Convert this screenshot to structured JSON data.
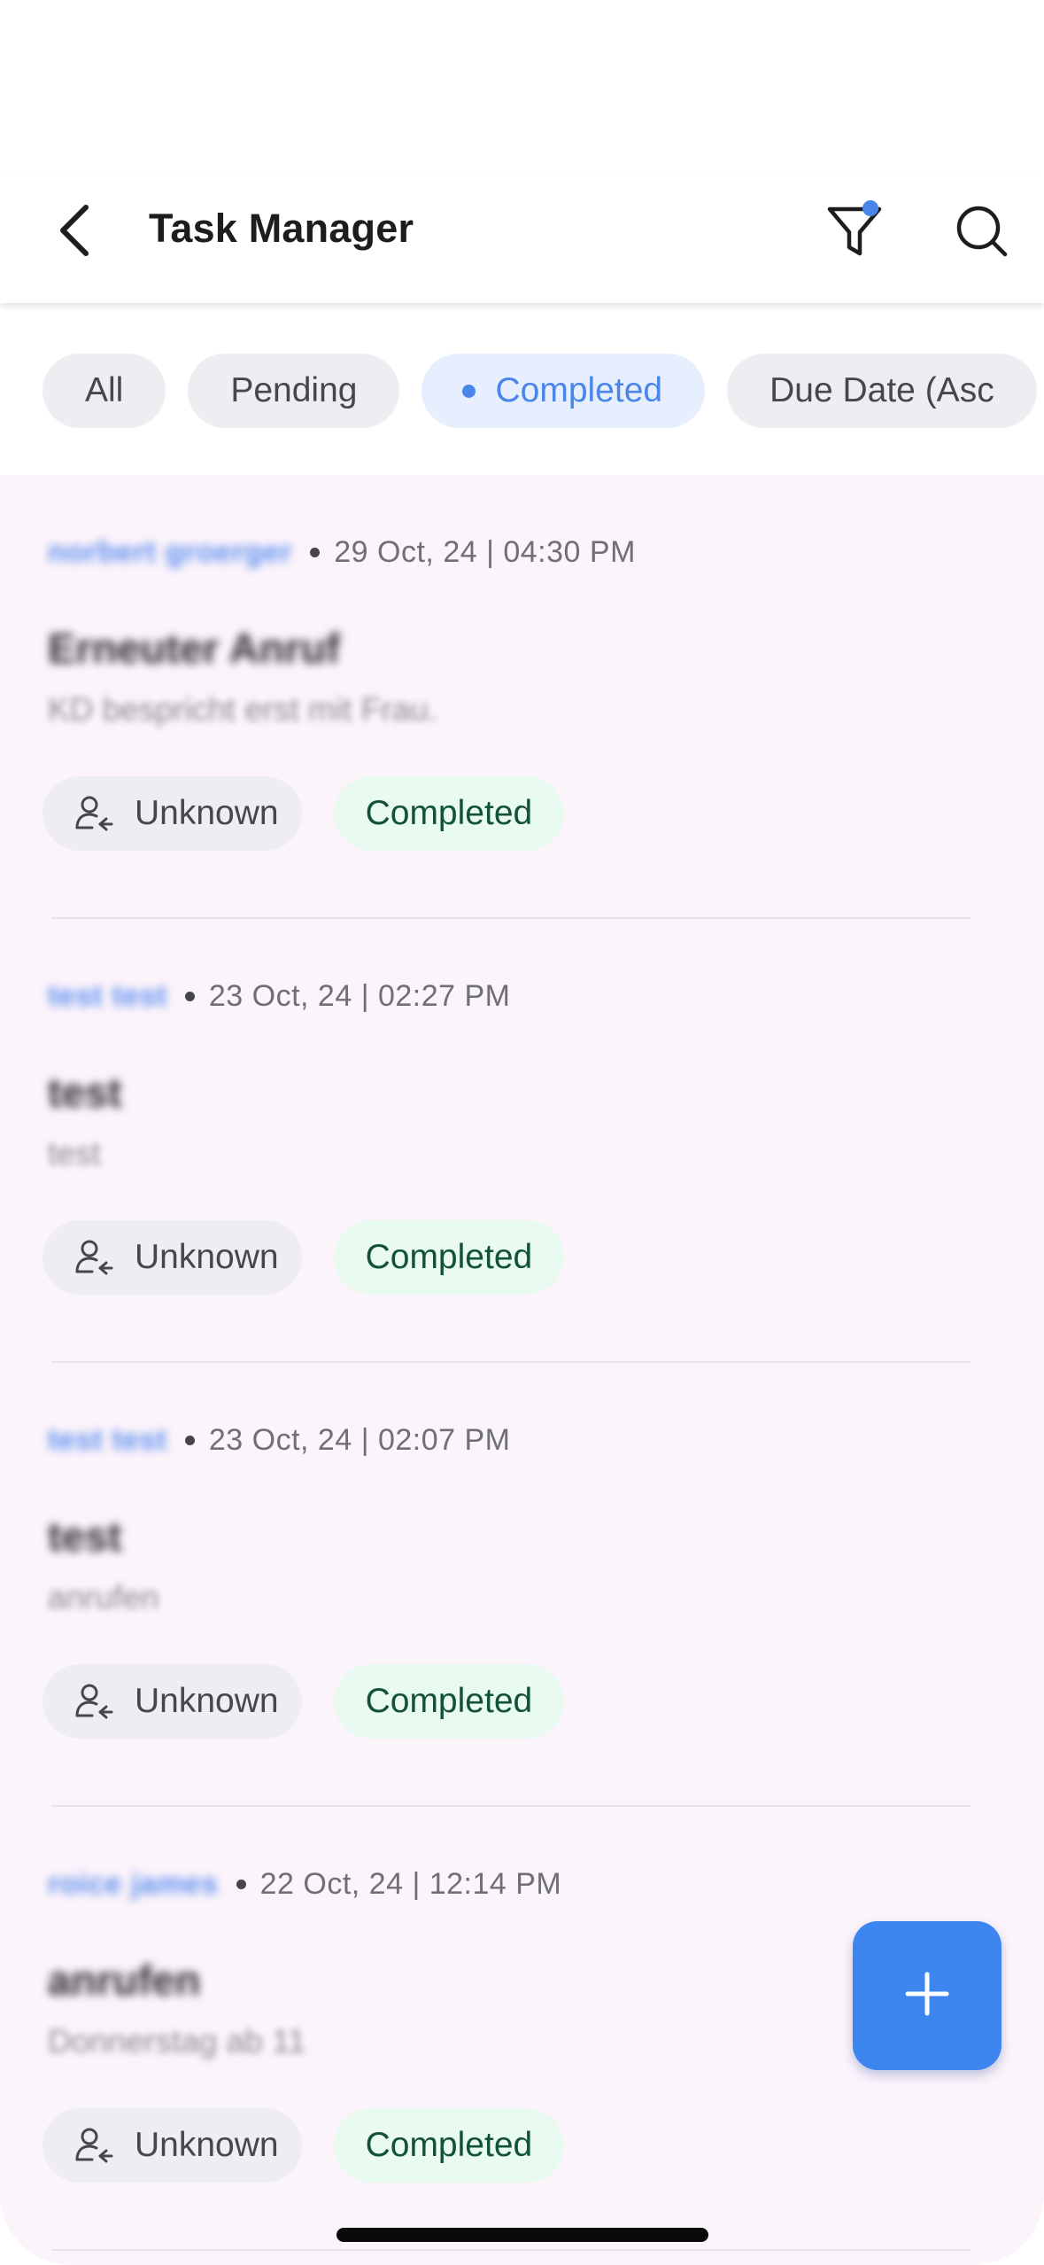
{
  "colors": {
    "accent": "#4a86e8",
    "fab": "#3d86f0",
    "list_background": "#fcf4fb",
    "completed_bg": "#e9faf0",
    "completed_text": "#12513a"
  },
  "header": {
    "title": "Task Manager",
    "back_icon": "chevron-left-icon",
    "filter_icon": "filter-icon",
    "search_icon": "search-icon"
  },
  "filters": {
    "chips": [
      {
        "label": "All"
      },
      {
        "label": "Pending"
      },
      {
        "label": "Completed",
        "selected": true
      },
      {
        "label": "Due Date (Asc"
      }
    ]
  },
  "tasks": [
    {
      "owner": "norbert groerger",
      "datetime": "29 Oct, 24 | 04:30 PM",
      "title": "Erneuter Anruf",
      "description": "KD bespricht erst mit Frau.",
      "assignee": "Unknown",
      "status": "Completed"
    },
    {
      "owner": "test test",
      "datetime": "23 Oct, 24 | 02:27 PM",
      "title": "test",
      "description": "test",
      "assignee": "Unknown",
      "status": "Completed"
    },
    {
      "owner": "test test",
      "datetime": "23 Oct, 24 | 02:07 PM",
      "title": "test",
      "description": "anrufen",
      "assignee": "Unknown",
      "status": "Completed"
    },
    {
      "owner": "roice james",
      "datetime": "22 Oct, 24 | 12:14 PM",
      "title": "anrufen",
      "description": "Donnerstag ab 11",
      "assignee": "Unknown",
      "status": "Completed"
    }
  ],
  "fab": {
    "icon": "plus-icon"
  }
}
